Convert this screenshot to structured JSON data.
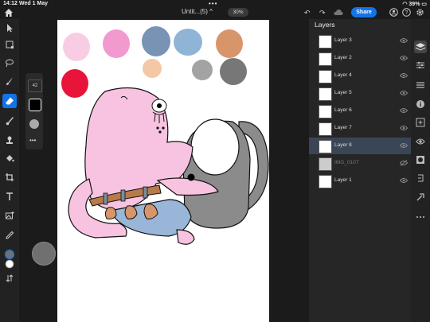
{
  "status": {
    "time": "14:12",
    "date": "Wed 1 May",
    "battery": "39%"
  },
  "header": {
    "doc_title": "Untit...(5) ^",
    "zoom": "30%",
    "undo_icon": "undo-arrow",
    "redo_icon": "redo-arrow",
    "share_label": "Share"
  },
  "brush": {
    "size": "42"
  },
  "layers": {
    "title": "Layers",
    "items": [
      {
        "name": "Layer 3",
        "selected": false,
        "visible": true
      },
      {
        "name": "Layer 2",
        "selected": false,
        "visible": true
      },
      {
        "name": "Layer 4",
        "selected": false,
        "visible": true
      },
      {
        "name": "Layer 5",
        "selected": false,
        "visible": true
      },
      {
        "name": "Layer 6",
        "selected": false,
        "visible": true
      },
      {
        "name": "Layer 7",
        "selected": false,
        "visible": true
      },
      {
        "name": "Layer 8",
        "selected": true,
        "visible": true
      },
      {
        "name": "IMG_0107",
        "selected": false,
        "visible": false
      },
      {
        "name": "Layer 1",
        "selected": false,
        "visible": true
      }
    ]
  },
  "palette": [
    "#f8cde3",
    "#f09ad0",
    "#7893b3",
    "#90b4d6",
    "#d9956a",
    "#e8143a",
    "#f4c8a4",
    "#a3a3a3",
    "#777777"
  ],
  "colors": {
    "accent": "#1473e6",
    "foreground": "#707070",
    "background": "#ffffff"
  }
}
